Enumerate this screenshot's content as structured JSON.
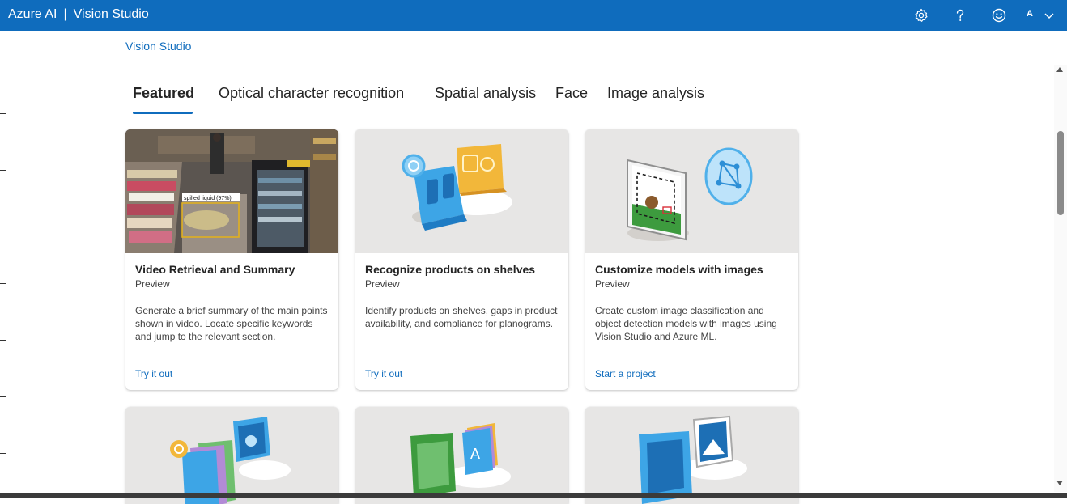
{
  "app": {
    "brand": "Azure AI",
    "separator": "|",
    "product": "Vision Studio",
    "avatar_initial": "A"
  },
  "header_icons": [
    "gear-icon",
    "help-icon",
    "feedback-smiley-icon",
    "chevron-down-icon"
  ],
  "breadcrumb": "Vision Studio",
  "tabs": [
    {
      "label": "Featured",
      "active": true
    },
    {
      "label": "Optical character recognition",
      "active": false
    },
    {
      "label": "Spatial analysis",
      "active": false
    },
    {
      "label": "Face",
      "active": false
    },
    {
      "label": "Image analysis",
      "active": false
    }
  ],
  "cards": [
    {
      "title": "Video Retrieval and Summary",
      "badge": "Preview",
      "description": "Generate a brief summary of the main points shown in video. Locate specific keywords and jump to the relevant section.",
      "action": "Try it out",
      "image_label": "spilled liquid (97%)"
    },
    {
      "title": "Recognize products on shelves",
      "badge": "Preview",
      "description": "Identify products on shelves, gaps in product availability, and compliance for planograms.",
      "action": "Try it out"
    },
    {
      "title": "Customize models with images",
      "badge": "Preview",
      "description": "Create custom image classification and object detection models with images using Vision Studio and Azure ML.",
      "action": "Start a project"
    }
  ],
  "colors": {
    "header": "#0f6cbd",
    "accent": "#0f6cbd",
    "card_image_bg": "#e7e6e5"
  }
}
